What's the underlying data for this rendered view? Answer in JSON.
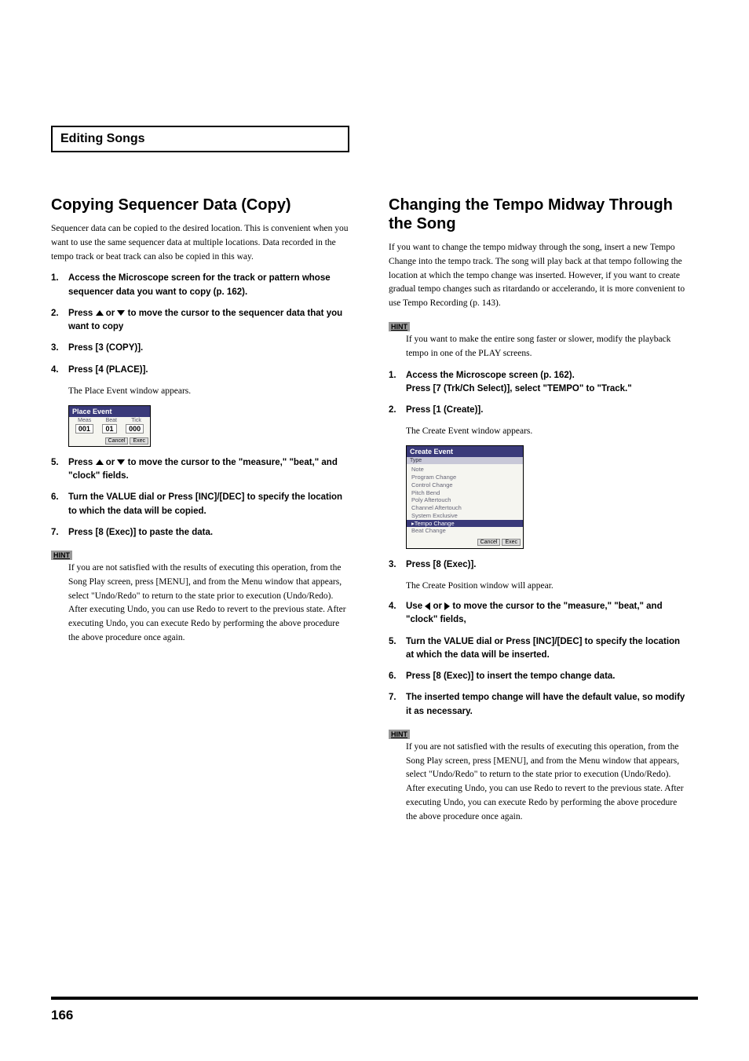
{
  "section_header": "Editing Songs",
  "page_number": "166",
  "left": {
    "title": "Copying Sequencer Data (Copy)",
    "intro": "Sequencer data can be copied to the desired location. This is convenient when you want to use the same sequencer data at multiple locations. Data recorded in the tempo track or beat track can also be copied in this way.",
    "steps": {
      "s1": "Access the Microscope screen for the track or pattern whose sequencer data you want to copy (p. 162).",
      "s2a": "Press ",
      "s2b": " or ",
      "s2c": " to move the cursor to the sequencer data that you want to copy",
      "s3": "Press [3 (COPY)].",
      "s4": "Press [4 (PLACE)].",
      "s4_sub": "The Place Event window appears.",
      "s5a": "Press ",
      "s5b": " or ",
      "s5c": " to move the cursor to the \"measure,\" \"beat,\" and \"clock\" fields.",
      "s6": "Turn the VALUE dial or Press [INC]/[DEC] to specify the location to which the data will be copied.",
      "s7": "Press [8 (Exec)] to paste the data."
    },
    "hint_label": "HINT",
    "hint": "If you are not satisfied with the results of executing this operation, from the Song Play screen, press [MENU], and from the Menu window that appears, select \"Undo/Redo\" to return to the state prior to execution (Undo/Redo).\nAfter executing Undo, you can use Redo to revert to the previous state. After executing Undo, you can execute Redo by performing the above procedure the above procedure once again.",
    "place_event": {
      "title": "Place Event",
      "labels": [
        "Meas",
        "Beat",
        "Tick"
      ],
      "values": [
        "001",
        "01",
        "000"
      ],
      "buttons": [
        "Cancel",
        "Exec"
      ]
    }
  },
  "right": {
    "title": "Changing the Tempo Midway Through the Song",
    "intro": "If you want to change the tempo midway through the song, insert a new Tempo Change into the tempo track. The song will play back at that tempo following the location at which the tempo change was inserted. However, if you want to create gradual tempo changes such as ritardando or accelerando, it is more convenient to use Tempo Recording (p. 143).",
    "hint1_label": "HINT",
    "hint1": "If you want to make the entire song faster or slower, modify the playback tempo in one of the PLAY screens.",
    "steps": {
      "s1a": "Access the Microscope screen (p. 162).",
      "s1b": "Press [7 (Trk/Ch Select)], select \"TEMPO\" to \"Track.\"",
      "s2": "Press [1 (Create)].",
      "s2_sub": "The Create Event window appears.",
      "s3": "Press [8 (Exec)].",
      "s3_sub": "The Create Position window will appear.",
      "s4a": "Use ",
      "s4b": " or ",
      "s4c": " to move the cursor to the \"measure,\" \"beat,\" and \"clock\" fields,",
      "s5": "Turn the VALUE dial or Press [INC]/[DEC] to specify the location at which the data will be inserted.",
      "s6": "Press [8 (Exec)] to insert the tempo change data.",
      "s7": "The inserted tempo change will have the default value, so modify it as necessary."
    },
    "hint2_label": "HINT",
    "hint2": "If you are not satisfied with the results of executing this operation, from the Song Play screen, press [MENU], and from the Menu window that appears, select \"Undo/Redo\" to return to the state prior to execution (Undo/Redo).\nAfter executing Undo, you can use Redo to revert to the previous state. After executing Undo, you can execute Redo by performing the above procedure the above procedure once again.",
    "create_event": {
      "title": "Create Event",
      "sub": "Type",
      "items": [
        "Note",
        "Program Change",
        "Control Change",
        "Pitch Bend",
        "Poly Aftertouch",
        "Channel Aftertouch",
        "System Exclusive"
      ],
      "selected": "▸Tempo Change",
      "after": "Beat Change",
      "buttons": [
        "Cancel",
        "Exec"
      ]
    }
  }
}
